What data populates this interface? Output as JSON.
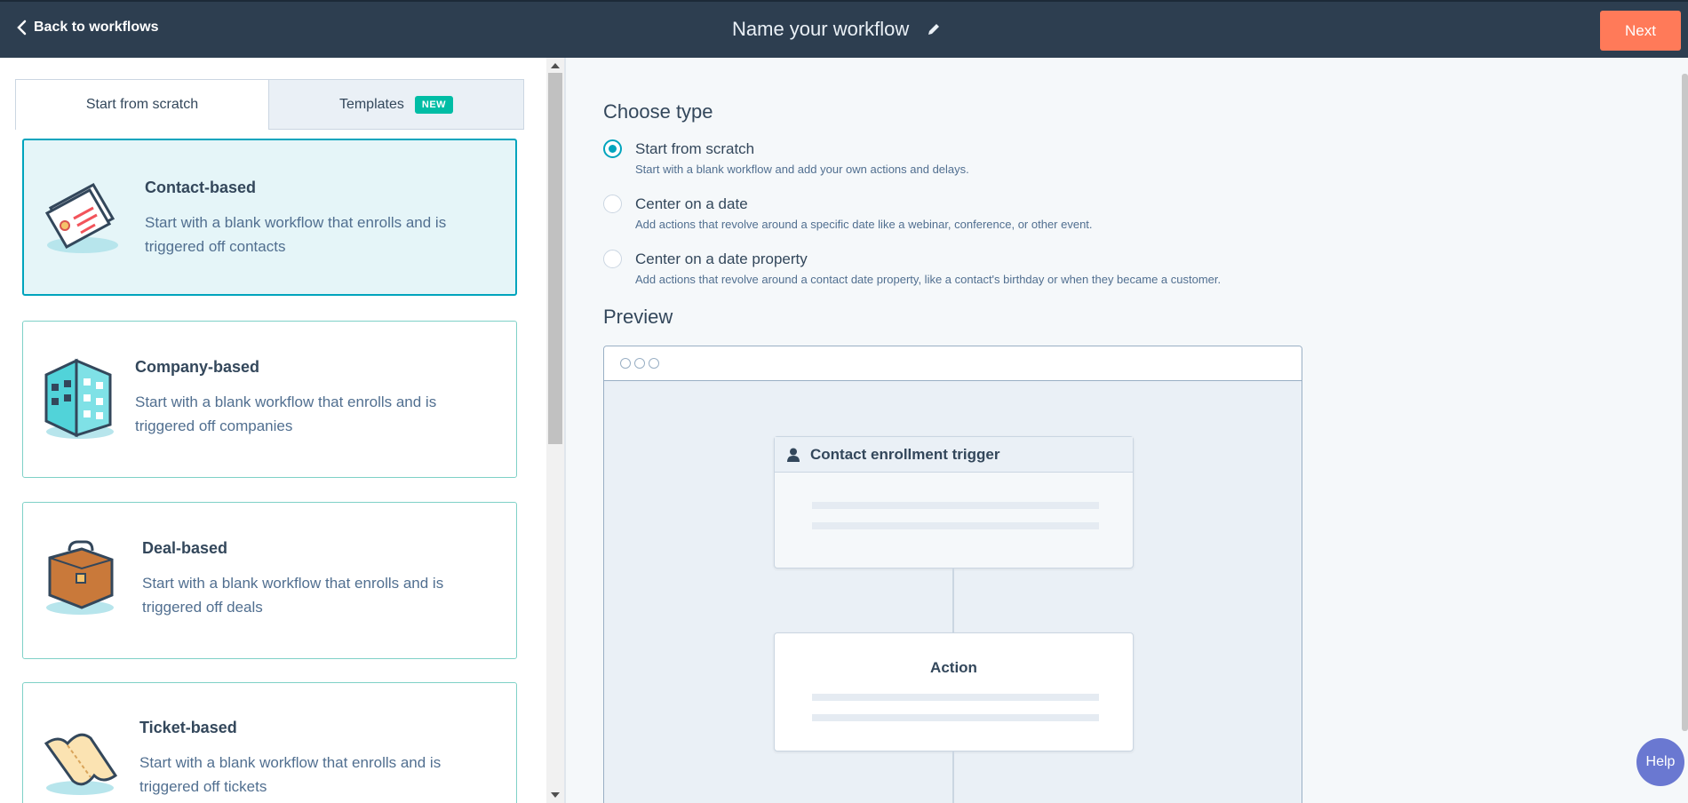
{
  "header": {
    "back_label": "Back to workflows",
    "title": "Name your workflow",
    "next_label": "Next"
  },
  "tabs": [
    {
      "label": "Start from scratch",
      "active": true
    },
    {
      "label": "Templates",
      "badge": "NEW",
      "active": false
    }
  ],
  "cards": [
    {
      "title": "Contact-based",
      "description": "Start with a blank workflow that enrolls and is triggered off contacts",
      "icon": "contact-card-icon",
      "selected": true
    },
    {
      "title": "Company-based",
      "description": "Start with a blank workflow that enrolls and is triggered off companies",
      "icon": "building-icon",
      "selected": false
    },
    {
      "title": "Deal-based",
      "description": "Start with a blank workflow that enrolls and is triggered off deals",
      "icon": "briefcase-icon",
      "selected": false
    },
    {
      "title": "Ticket-based",
      "description": "Start with a blank workflow that enrolls and is triggered off tickets",
      "icon": "ticket-icon",
      "selected": false
    }
  ],
  "choose_type": {
    "heading": "Choose type",
    "options": [
      {
        "label": "Start from scratch",
        "description": "Start with a blank workflow and add your own actions and delays.",
        "selected": true
      },
      {
        "label": "Center on a date",
        "description": "Add actions that revolve around a specific date like a webinar, conference, or other event.",
        "selected": false
      },
      {
        "label": "Center on a date property",
        "description": "Add actions that revolve around a contact date property, like a contact's birthday or when they became a customer.",
        "selected": false
      }
    ]
  },
  "preview": {
    "heading": "Preview",
    "trigger_label": "Contact enrollment trigger",
    "action_label": "Action"
  },
  "help_label": "Help",
  "colors": {
    "topbar": "#2d3e50",
    "next": "#ff7a59",
    "accent": "#00a4bd",
    "badge": "#00bda5",
    "help": "#6a78d1"
  }
}
